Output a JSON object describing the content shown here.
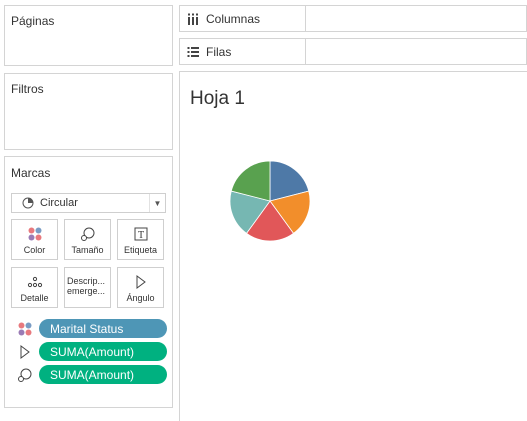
{
  "left": {
    "paginas": {
      "title": "Páginas"
    },
    "filtros": {
      "title": "Filtros"
    },
    "marcas": {
      "title": "Marcas",
      "mark_type": "Circular",
      "cards": {
        "color": "Color",
        "tamano": "Tamaño",
        "etiqueta": "Etiqueta",
        "detalle": "Detalle",
        "descripcion": "Descrip... emerge...",
        "angulo": "Ángulo"
      },
      "pills": [
        {
          "label": "Marital Status",
          "role": "color",
          "icon": "color-dots-icon"
        },
        {
          "label": "SUMA(Amount)",
          "role": "angle",
          "icon": "angle-icon"
        },
        {
          "label": "SUMA(Amount)",
          "role": "size",
          "icon": "size-icon"
        }
      ]
    }
  },
  "shelves": {
    "columnas": {
      "label": "Columnas",
      "icon": "columns-icon"
    },
    "filas": {
      "label": "Filas",
      "icon": "rows-icon"
    }
  },
  "view": {
    "sheet_title": "Hoja 1"
  },
  "colors": {
    "dimension_pill": "#4e96b6",
    "measure_pill": "#00b180"
  },
  "chart_data": {
    "type": "pie",
    "slices": [
      {
        "value": 21,
        "color": "#4e79a7"
      },
      {
        "value": 19,
        "color": "#f28e2b"
      },
      {
        "value": 20,
        "color": "#e15759"
      },
      {
        "value": 19,
        "color": "#76b7b2"
      },
      {
        "value": 21,
        "color": "#59a14f"
      }
    ],
    "legend": "none"
  }
}
